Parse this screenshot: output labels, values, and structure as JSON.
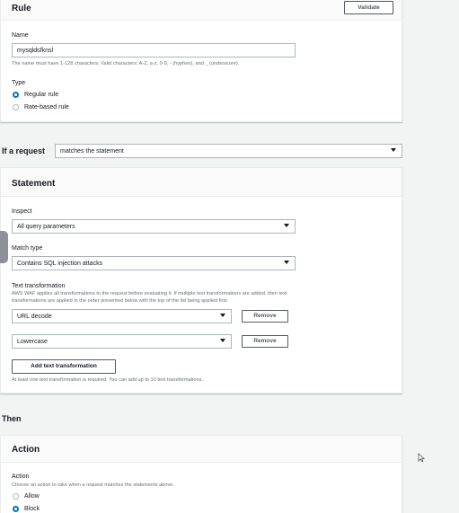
{
  "rule": {
    "title": "Rule",
    "validate_label": "Validate",
    "name_label": "Name",
    "name_value": "mysqldsfknsl",
    "name_hint": "The name must have 1-128 characters. Valid characters: A-Z, a-z, 0-9, - (hyphen), and _ (underscore).",
    "type_label": "Type",
    "type_options": [
      "Regular rule",
      "Rate-based rule"
    ],
    "type_selected": "Regular rule"
  },
  "request": {
    "label": "If a request",
    "select_value": "matches the statement"
  },
  "statement": {
    "title": "Statement",
    "inspect_label": "Inspect",
    "inspect_value": "All query parameters",
    "match_type_label": "Match type",
    "match_type_value": "Contains SQL injection attacks",
    "text_transformation_label": "Text transformation",
    "text_transformation_hint_1": "AWS WAF applies all transformations to the request before evaluating it. If multiple text transformations are added, then text",
    "text_transformation_hint_2": "transformations are applied in the order presented below with the top of the list being applied first.",
    "transformations": [
      {
        "value": "URL decode",
        "remove_label": "Remove"
      },
      {
        "value": "Lowercase",
        "remove_label": "Remove"
      }
    ],
    "add_label": "Add text transformation",
    "footer_hint": "At least one text transformation is required. You can add up to 10 text transformations."
  },
  "then": {
    "title": "Then"
  },
  "action": {
    "title": "Action",
    "action_label": "Action",
    "action_hint": "Choose an action to take when a request matches the statements above.",
    "options": [
      "Allow",
      "Block"
    ],
    "selected": "Block"
  }
}
